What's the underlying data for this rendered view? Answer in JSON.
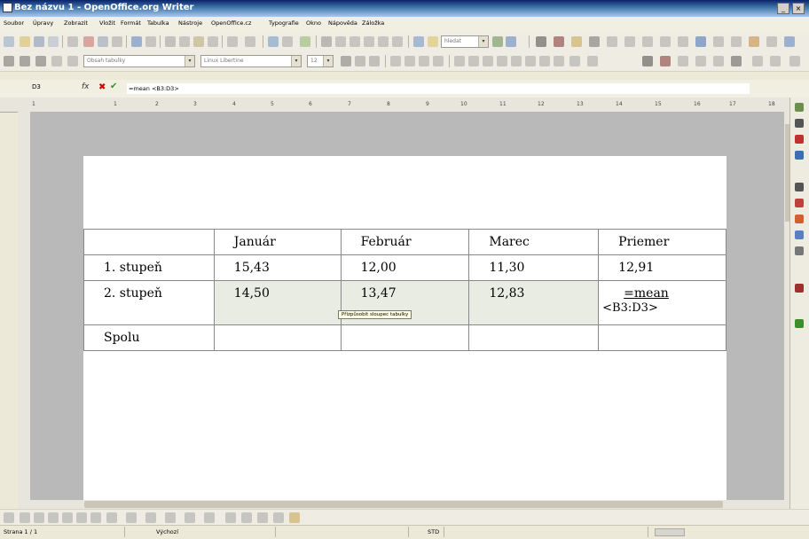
{
  "window": {
    "title": "Bez názvu 1 - OpenOffice.org Writer"
  },
  "menu": [
    "Soubor",
    "Úpravy",
    "Zobrazit",
    "Vložit",
    "Formát",
    "Tabulka",
    "Nástroje",
    "OpenOffice.cz",
    "Typografie",
    "Okno",
    "Nápověda",
    "Záložka"
  ],
  "toolbar": {
    "search_value": "hledat",
    "style_value": "Obsah tabulky",
    "font_value": "Linux Libertine",
    "size_value": "12"
  },
  "formula_bar": {
    "cell_ref": "D3",
    "fx": "fx",
    "cancel": "✖",
    "ok": "✔",
    "formula": "=mean <B3:D3>"
  },
  "ruler": [
    "1",
    "1",
    "2",
    "3",
    "4",
    "5",
    "6",
    "7",
    "8",
    "9",
    "10",
    "11",
    "12",
    "13",
    "14",
    "15",
    "16",
    "17",
    "18"
  ],
  "table": {
    "headers": [
      "",
      "Január",
      "Február",
      "Marec",
      "Priemer"
    ],
    "rows": [
      [
        "1. stupeň",
        "15,43",
        "12,00",
        "11,30",
        "12,91"
      ],
      [
        "2. stupeň",
        "14,50",
        "13,47",
        "12,83",
        ""
      ],
      [
        "Spolu",
        "",
        "",
        "",
        ""
      ]
    ],
    "editing_cell_line1": "=mean",
    "editing_cell_line2": "<B3:D3>"
  },
  "tooltip": "Přizpůsobit sloupec tabulky",
  "statusbar": {
    "page": "Strana 1 / 1",
    "style": "Výchozí",
    "mode": "STD"
  }
}
